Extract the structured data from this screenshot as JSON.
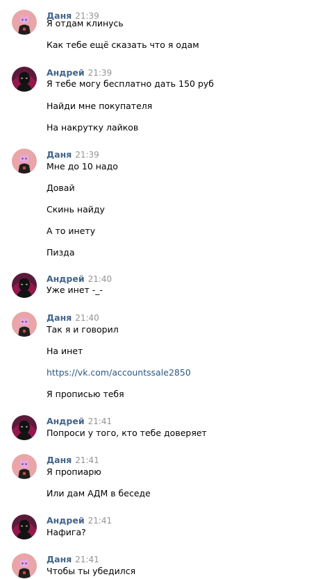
{
  "messages": [
    {
      "author": "Даня",
      "time": "21:39",
      "lines": [
        "Я отдам клинусь",
        "Как тебе ещё сказать что я одам"
      ]
    },
    {
      "author": "Андрей",
      "time": "21:39",
      "lines": [
        "Я тебе могу бесплатно дать 150 руб",
        "Найди мне покупателя",
        "На накрутку лайков"
      ]
    },
    {
      "author": "Даня",
      "time": "21:39",
      "lines": [
        "Мне до 10 надо",
        "Довай",
        "Скинь найду",
        "А то инету",
        "Пизда"
      ]
    },
    {
      "author": "Андрей",
      "time": "21:40",
      "lines": [
        "Уже инет -_-"
      ]
    },
    {
      "author": "Даня",
      "time": "21:40",
      "lines": [
        "Так я и говорил",
        "На инет",
        "https://vk.com/accountssale2850",
        "Я прописью тебя"
      ]
    },
    {
      "author": "Андрей",
      "time": "21:41",
      "lines": [
        "Попроси у того, кто тебе доверяет"
      ]
    },
    {
      "author": "Даня",
      "time": "21:41",
      "lines": [
        "Я пропиарю",
        "Или дам АДМ в беседе"
      ]
    },
    {
      "author": "Андрей",
      "time": "21:41",
      "lines": [
        "Нафига?"
      ]
    },
    {
      "author": "Даня",
      "time": "21:41",
      "lines": [
        "Чтобы ты убедился"
      ]
    }
  ],
  "colors": {
    "author": "#42648b",
    "time": "#939393",
    "link": "#2a5885",
    "dania_avatar_bg": "#e9a5a8",
    "andrey_avatar_bg": "#5a1a3a"
  },
  "icons": {
    "dania_avatar": "pink-cat-emoji-avatar",
    "andrey_avatar": "dark-hooded-figure-avatar"
  }
}
